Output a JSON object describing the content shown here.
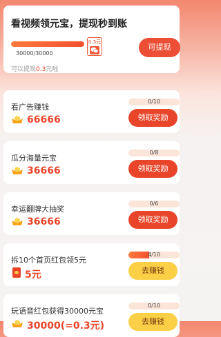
{
  "header": {
    "title": "看视频领元宝，提现秒到账",
    "progress_text": "30000/30000",
    "progress": 1.0,
    "reward_amount": "0.3元",
    "reward_icon": "wechat-icon",
    "hint_prefix": "可以提现",
    "hint_amount": "0.3",
    "hint_suffix": "元啦",
    "withdraw_label": "可提现"
  },
  "tasks": [
    {
      "title": "看广告赚钱",
      "amount": "66666",
      "icon": "gold-ingot-icon",
      "progress_text": "0/10",
      "progress": 0.0,
      "button": "领取奖励"
    },
    {
      "title": "瓜分海量元宝",
      "amount": "36666",
      "icon": "gold-ingot-icon",
      "progress_text": "0/8",
      "progress": 0.0,
      "button": "领取奖励"
    },
    {
      "title": "幸运翻牌大抽奖",
      "amount": "36666",
      "icon": "gold-ingot-icon",
      "progress_text": "0/6",
      "progress": 0.0,
      "button": "领取奖励"
    },
    {
      "title": "拆10个首页红包领5元",
      "amount": "5元",
      "icon": "red-packet-icon",
      "progress_text": "4/10",
      "progress": 0.4,
      "button": "去赚钱"
    },
    {
      "title": "玩语音红包获得30000元宝",
      "amount": "30000(=0.3元)",
      "icon": "gold-ingot-icon",
      "progress_text": "0/10",
      "progress": 0.0,
      "button": "去赚钱"
    }
  ],
  "colors": {
    "accent": "#e8452a",
    "yellow_button": "#fbd047",
    "progress_fill": "#f2512f"
  }
}
